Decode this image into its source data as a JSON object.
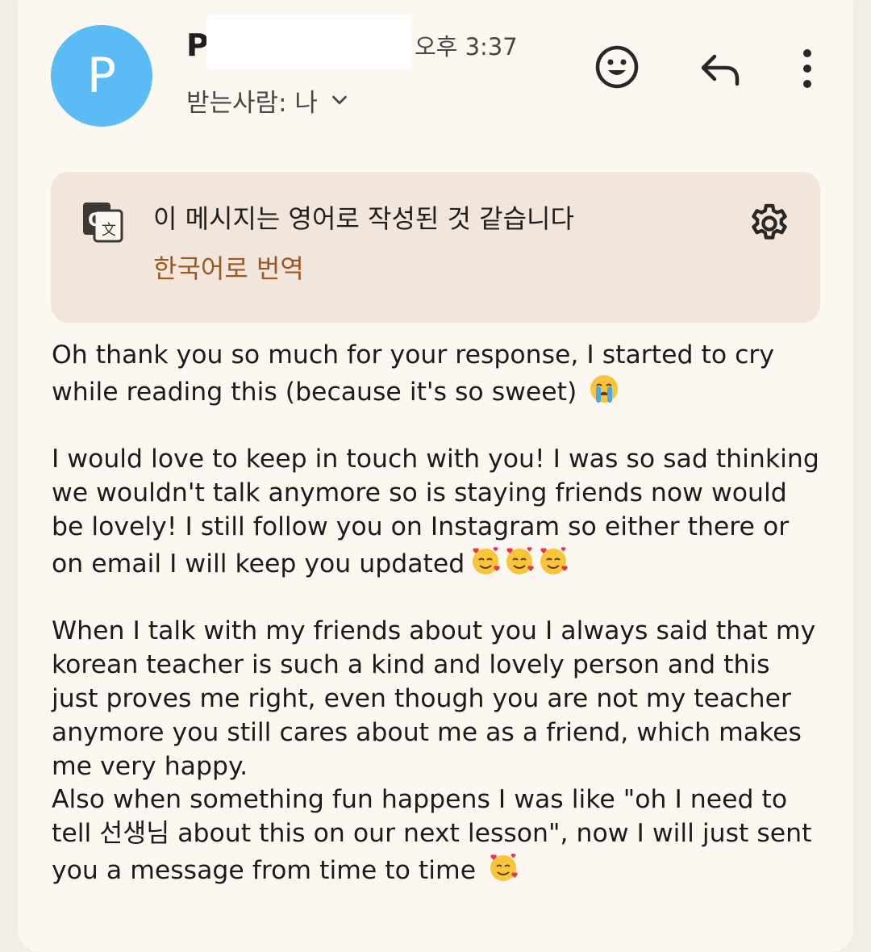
{
  "header": {
    "avatar_initial": "P",
    "sender_name": "P",
    "time": "오후 3:37",
    "recipient": "받는사람: 나"
  },
  "actions": {
    "emoji_icon": "emoji-smile-icon",
    "reply_icon": "reply-arrow-icon",
    "more_icon": "more-vertical-icon"
  },
  "translate_banner": {
    "message": "이 메시지는 영어로 작성된 것 같습니다",
    "link": "한국어로 번역",
    "link_color": "#9a5a1f",
    "icon": "google-translate-icon",
    "settings_icon": "gear-icon"
  },
  "body": {
    "p1": [
      "Oh thank you so much for your response, I started to cry",
      "while reading this (because it's so sweet)"
    ],
    "p2": [
      "I would love to keep in touch with you! I was so sad thinking",
      "we wouldn't talk anymore so is staying friends now would",
      "be lovely! I still follow you on Instagram so either there or",
      "on email I will keep you updated"
    ],
    "p3": [
      "When I talk with my friends about you I always said that my",
      "korean teacher is such a kind and lovely person and this",
      "just proves me right, even though you are not my teacher",
      "anymore you still cares about me as a friend, which makes",
      "me very happy.",
      "Also when something fun happens I was like \"oh I need to",
      "tell 선생님 about this on our next lesson\", now I will just sent",
      "you a message from time to time"
    ]
  },
  "colors": {
    "avatar": "#5bbbf4",
    "banner_bg": "#f2e5dc",
    "card_bg": "#fdf7f2"
  }
}
